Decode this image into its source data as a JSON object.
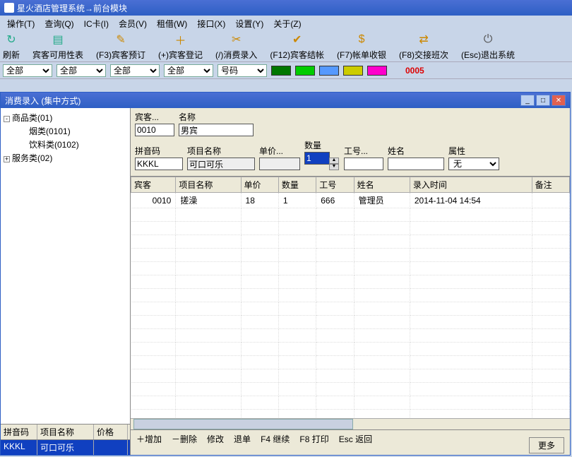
{
  "app_title": "星火酒店管理系统→前台模块",
  "menu": [
    "操作(T)",
    "查询(Q)",
    "IC卡(I)",
    "会员(V)",
    "租借(W)",
    "接口(X)",
    "设置(Y)",
    "关于(Z)"
  ],
  "toolbar": [
    {
      "label": "刷新",
      "icon": "↻",
      "color": "#2a8"
    },
    {
      "label": "宾客可用性表",
      "icon": "▤",
      "color": "#2a8"
    },
    {
      "label": "(F3)宾客预订",
      "icon": "✎",
      "color": "#c80"
    },
    {
      "label": "(+)宾客登记",
      "icon": "＋",
      "color": "#c80"
    },
    {
      "label": "(/)消费录入",
      "icon": "✂",
      "color": "#c80"
    },
    {
      "label": "(F12)宾客结帐",
      "icon": "✔",
      "color": "#c80"
    },
    {
      "label": "(F7)帐单收银",
      "icon": "$",
      "color": "#c80"
    },
    {
      "label": "(F8)交接班次",
      "icon": "⇄",
      "color": "#c80"
    },
    {
      "label": "(Esc)退出系统",
      "icon": "⏻",
      "color": "#555"
    }
  ],
  "filters": {
    "combos": [
      "全部",
      "全部",
      "全部",
      "全部",
      "号码"
    ],
    "swatches": [
      "#007700",
      "#00cc00",
      "#5599ff",
      "#cccc00",
      "#ff00cc"
    ],
    "counter": "0005"
  },
  "dialog": {
    "title": "消费录入 (集中方式)",
    "tree": [
      {
        "label": "商品类(01)",
        "expand": "-",
        "indent": 0
      },
      {
        "label": "烟类(0101)",
        "expand": "",
        "indent": 2
      },
      {
        "label": "饮料类(0102)",
        "expand": "",
        "indent": 2
      },
      {
        "label": "服务类(02)",
        "expand": "+",
        "indent": 0
      }
    ],
    "small_grid": {
      "headers": [
        "拼音码",
        "项目名称",
        "价格"
      ],
      "row": [
        "KKKL",
        "可口可乐",
        ""
      ]
    },
    "form": {
      "guest_label": "宾客...",
      "guest_value": "0010",
      "name_label": "名称",
      "name_value": "男宾",
      "py_label": "拼音码",
      "py_value": "KKKL",
      "item_label": "项目名称",
      "item_value": "可口可乐",
      "price_label": "单价...",
      "price_value": "",
      "qty_label": "数量",
      "qty_value": "1",
      "staffid_label": "工号...",
      "staffid_value": "",
      "staffname_label": "姓名",
      "staffname_value": "",
      "attr_label": "属性",
      "attr_value": "无"
    },
    "grid": {
      "headers": [
        "宾客",
        "项目名称",
        "单价",
        "数量",
        "工号",
        "姓名",
        "录入时间",
        "备注"
      ],
      "rows": [
        [
          "0010",
          "搓澡",
          "18",
          "1",
          "666",
          "管理员",
          "2014-11-04 14:54",
          ""
        ]
      ]
    },
    "footer_actions": [
      "＋增加",
      "－删除",
      "修改",
      "退单",
      "F4 继续",
      "F8 打印",
      "Esc 返回"
    ],
    "more_label": "更多"
  }
}
